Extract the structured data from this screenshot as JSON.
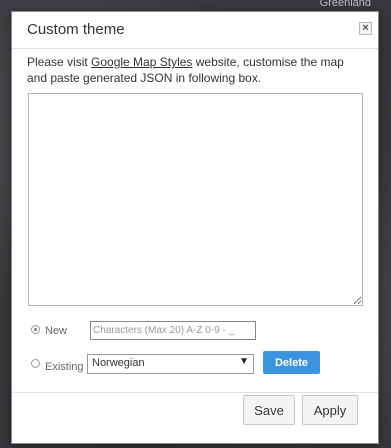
{
  "background": {
    "map_label": "Greenland"
  },
  "dialog": {
    "title": "Custom theme",
    "close_glyph": "×",
    "intro_prefix": "Please visit ",
    "intro_link": "Google Map Styles",
    "intro_suffix": " website, customise the map and paste generated JSON in following box.",
    "json_value": "",
    "new_label": "New",
    "new_placeholder": "Characters (Max 20) A-Z 0-9 - _",
    "existing_label": "Existing",
    "existing_selected": "Norwegian",
    "delete_label": "Delete",
    "save_label": "Save",
    "apply_label": "Apply"
  },
  "colors": {
    "accent": "#3c94e0"
  }
}
